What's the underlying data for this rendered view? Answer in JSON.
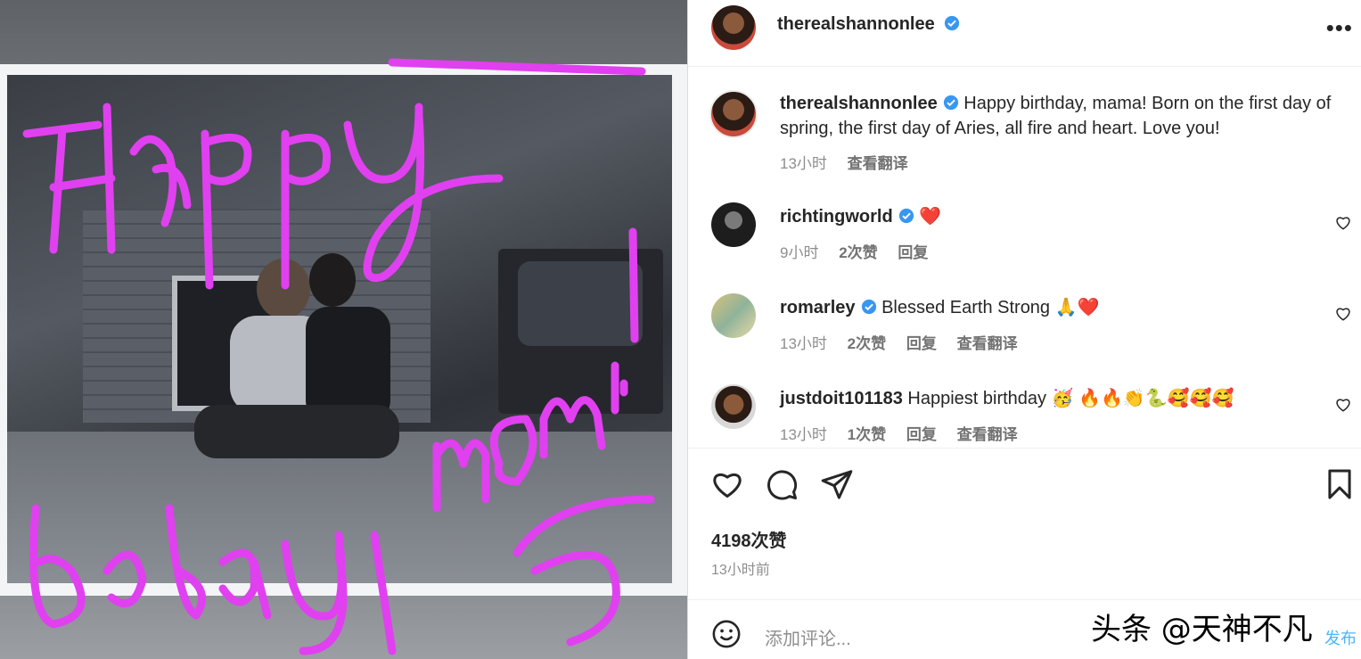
{
  "post": {
    "author": "therealshannonlee",
    "caption": "Happy birthday, mama! Born on the first day of spring, the first day of Aries, all fire and heart. Love you!",
    "caption_time": "13小时",
    "caption_translate": "查看翻译",
    "likes": "4198次赞",
    "posted_ago": "13小时前"
  },
  "comments": [
    {
      "user": "richtingworld",
      "text": "❤️",
      "time": "9小时",
      "likes": "2次赞",
      "reply": "回复",
      "translate": ""
    },
    {
      "user": "romarley",
      "text": "Blessed Earth Strong 🙏❤️",
      "time": "13小时",
      "likes": "2次赞",
      "reply": "回复",
      "translate": "查看翻译"
    },
    {
      "user": "justdoit101183",
      "text": "Happiest birthday 🥳 🔥🔥👏🐍🥰🥰🥰",
      "time": "13小时",
      "likes": "1次赞",
      "reply": "回复",
      "translate": "查看翻译"
    }
  ],
  "composer": {
    "placeholder": "添加评论...",
    "post_label": "发布",
    "watermark": "头条 @天神不凡"
  },
  "photo": {
    "scribble_text": "Happy Bday, Mom! ♡"
  },
  "colors": {
    "accent": "#4cb5f9",
    "verified": "#3897f0",
    "scribble": "#e040f0"
  },
  "icons": [
    "heart-icon",
    "comment-icon",
    "share-icon",
    "bookmark-icon",
    "emoji-icon",
    "more-icon",
    "verified-icon"
  ]
}
